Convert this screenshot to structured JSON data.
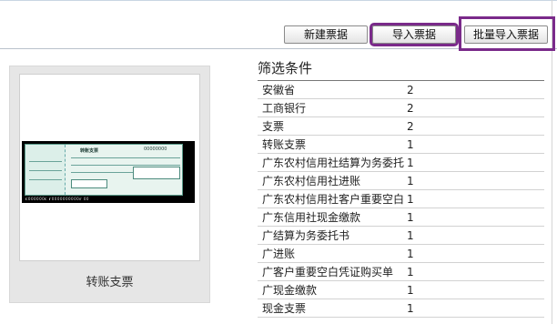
{
  "toolbar": {
    "new_label": "新建票据",
    "import_label": "导入票据",
    "batch_import_label": "批量导入票据"
  },
  "preview": {
    "label": "转账支票",
    "cheque_title": "转账支票",
    "cheque_number": "00000000"
  },
  "filter": {
    "title": "筛选条件",
    "rows": [
      {
        "name": "安徽省",
        "count": "2"
      },
      {
        "name": "工商银行",
        "count": "2"
      },
      {
        "name": "支票",
        "count": "2"
      },
      {
        "name": "转账支票",
        "count": "1"
      },
      {
        "name": "广东农村信用社结算为务委托",
        "count": "1"
      },
      {
        "name": "广东农村信用社进账",
        "count": "1"
      },
      {
        "name": "广东农村信用社客户重要空白",
        "count": "1"
      },
      {
        "name": "广东信用社现金缴款",
        "count": "1"
      },
      {
        "name": "广结算为务委托书",
        "count": "1"
      },
      {
        "name": "广进账",
        "count": "1"
      },
      {
        "name": "广客户重要空白凭证购买单",
        "count": "1"
      },
      {
        "name": "广现金缴款",
        "count": "1"
      },
      {
        "name": "现金支票",
        "count": "1"
      }
    ]
  },
  "colors": {
    "highlight": "#7a2a8a",
    "panel_bg": "#e6e6e6"
  }
}
